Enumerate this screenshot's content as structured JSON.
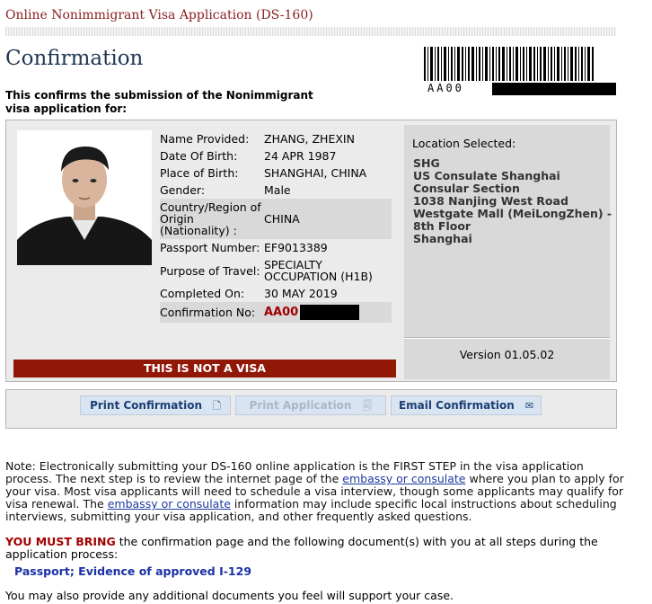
{
  "header": {
    "title": "Online Nonimmigrant Visa Application (DS-160)"
  },
  "page": {
    "title": "Confirmation",
    "intro": "This confirms the submission of the Nonimmigrant visa application for:"
  },
  "barcode": {
    "text": "AA00"
  },
  "applicant": {
    "details": [
      {
        "label": "Name Provided:",
        "value": "ZHANG, ZHEXIN"
      },
      {
        "label": "Date Of Birth:",
        "value": "24 APR 1987"
      },
      {
        "label": "Place of Birth:",
        "value": "SHANGHAI, CHINA"
      },
      {
        "label": "Gender:",
        "value": "Male"
      },
      {
        "label": "Country/Region of Origin (Nationality) :",
        "value": "CHINA"
      },
      {
        "label": "Passport Number:",
        "value": "EF9013389"
      },
      {
        "label": "Purpose of Travel:",
        "value": "SPECIALTY OCCUPATION (H1B)"
      },
      {
        "label": "Completed On:",
        "value": "30 MAY 2019"
      },
      {
        "label": "Confirmation No:",
        "value": "AA00"
      }
    ],
    "banner": "THIS IS NOT A VISA"
  },
  "location": {
    "label": "Location Selected:",
    "lines": [
      "SHG",
      "US Consulate Shanghai Consular Section",
      "1038 Nanjing West Road",
      "Westgate Mall (MeiLongZhen) - 8th Floor",
      "Shanghai"
    ],
    "version": "Version 01.05.02"
  },
  "buttons": {
    "print_confirmation": "Print Confirmation",
    "print_application": "Print Application",
    "email_confirmation": "Email Confirmation"
  },
  "note": {
    "p1_a": "Note: Electronically submitting your DS-160 online application is the FIRST STEP in the visa application process. The next step is to review the internet page of the ",
    "link1": "embassy or consulate",
    "p1_b": " where you plan to apply for your visa. Most visa applicants will need to schedule a visa interview, though some applicants may qualify for visa renewal. The ",
    "link2": "embassy or consulate",
    "p1_c": " information may include specific local instructions about scheduling interviews, submitting your visa application, and other frequently asked questions.",
    "must_bring": "YOU MUST BRING",
    "must_rest": " the confirmation page and the following document(s) with you at all steps during the application process:",
    "documents": "Passport; Evidence of approved I-129",
    "also": "You may also provide any additional documents you feel will support your case."
  }
}
